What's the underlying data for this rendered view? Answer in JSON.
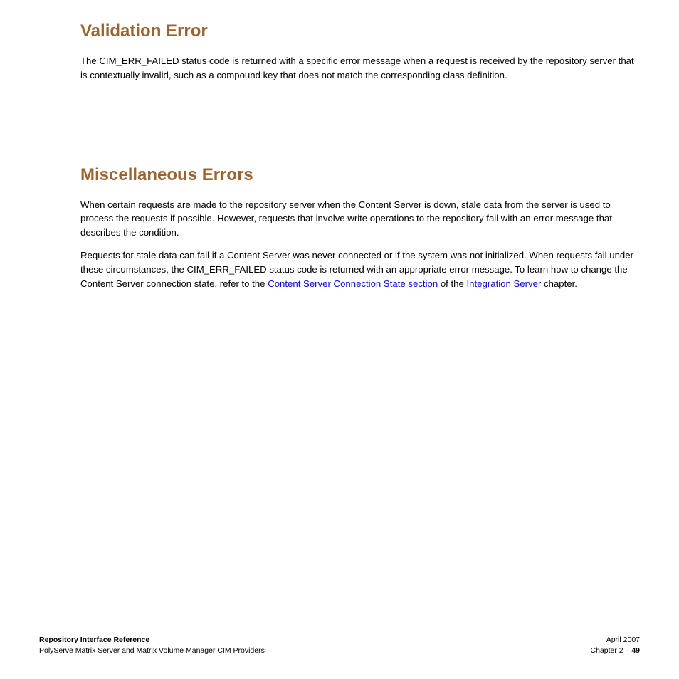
{
  "section1": {
    "title": "Validation Error",
    "para": "The CIM_ERR_FAILED status code is returned with a specific error message when a request is received by the repository server that is contextually invalid, such as a compound key that does not match the corresponding class definition."
  },
  "section2": {
    "title": "Miscellaneous Errors",
    "para1": "When certain requests are made to the repository server when the Content Server is down, stale data from the server is used to process the requests if possible. However, requests that involve write operations to the repository fail with an error message that describes the condition.",
    "para2": "Requests for stale data can fail if a Content Server was never connected or if the system was not initialized. When requests fail under these circumstances, the CIM_ERR_FAILED status code is returned with an appropriate error message. To learn how to change the Content Server connection state, refer to the",
    "link1": "Content Server Connection State section",
    "trailing1": " of the",
    "link2": "Integration Server",
    "trailing2": " chapter."
  },
  "footer": {
    "leftStrong": "Repository Interface Reference",
    "leftLine2": "PolyServe Matrix Server and Matrix Volume Manager CIM Providers",
    "rightDate": "April 2007",
    "rightPrefix": "Chapter 2 – ",
    "rightStrong": "49"
  }
}
